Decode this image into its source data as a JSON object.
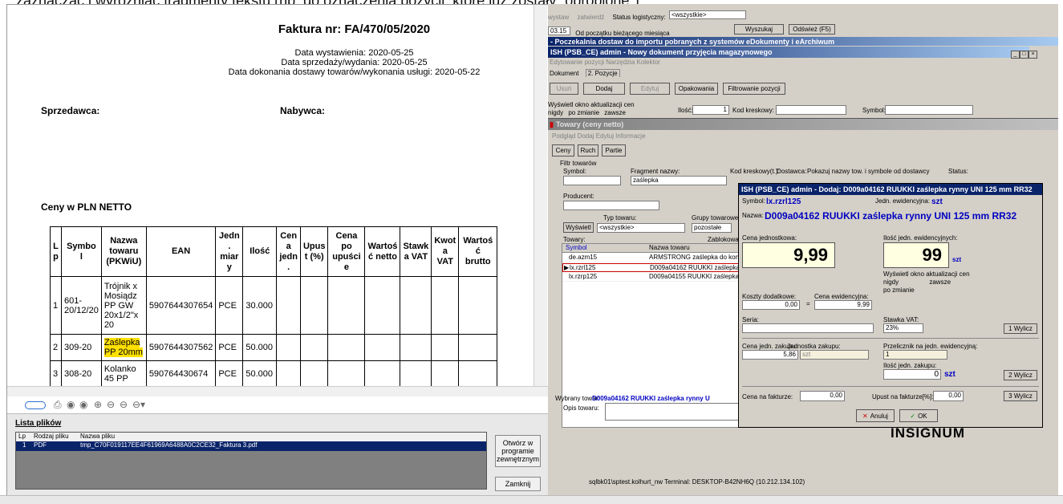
{
  "caption": "zaznaczać i wyróżniać fragmenty tekstu (np. do oznaczenia pozycji, które już zostały „obrobione\")",
  "invoice": {
    "title": "Faktura nr: FA/470/05/2020",
    "dates": [
      "Data wystawienia: 2020-05-25",
      "Data sprzedaży/wydania: 2020-05-25",
      "Data dokonania dostawy towarów/wykonania usługi: 2020-05-22"
    ],
    "seller": "Sprzedawca:",
    "buyer": "Nabywca:",
    "prices": "Ceny w PLN NETTO",
    "headers": [
      "Lp",
      "Symbol",
      "Nazwa towaru (PKWiU)",
      "EAN",
      "Jedn. miary",
      "Ilość",
      "Cena jedn.",
      "Upust (%)",
      "Cena po upuście",
      "Wartość netto",
      "Stawka VAT",
      "Kwota VAT",
      "Wartość brutto"
    ],
    "rows": [
      {
        "lp": "1",
        "symbol": "601-20/12/20",
        "name": "Trójnik x Mosiądz PP GW 20x1/2\"x 20",
        "ean": "5907644307654",
        "unit": "PCE",
        "qty": "30.000"
      },
      {
        "lp": "2",
        "symbol": "309-20",
        "name": "Zaślepka PP 20mm",
        "ean": "5907644307562",
        "unit": "PCE",
        "qty": "50.000"
      },
      {
        "lp": "3",
        "symbol": "308-20",
        "name": "Kolanko 45 PP",
        "ean": "590764430674",
        "unit": "PCE",
        "qty": "50.000"
      }
    ]
  },
  "files": {
    "title": "Lista plików",
    "cols": [
      "Lp",
      "Rodzaj pliku",
      "Nazwa pliku"
    ],
    "row": {
      "lp": "1",
      "type": "PDF",
      "name": "tmp_C70F019117EE4F61969A6488A0C2CE32_Faktura 3.pdf"
    },
    "open_btn": "Otwórz w programie zewnętrznym",
    "close_btn": "Zamknij"
  },
  "erp": {
    "top": {
      "c1": "wystaw",
      "c2": "zatwierdź",
      "status_label": "Status logistyczny:",
      "status_val": "<wszystkie>",
      "date": "03.15",
      "since": "Od początku bieżącego miesiąca",
      "search": "Wyszukaj",
      "refresh": "Odśwież (F5)"
    },
    "w_wait": "- Poczekalnia dostaw do importu pobranych z systemów eDokumenty i eArchiwum",
    "w_new": "ISH (PSB_CE) admin - Nowy dokument przyjęcia magazynowego",
    "menu1": "Edytowanie pozycji  Narzędzia  Kolektor",
    "tab_doc": "Dokument",
    "tab_pos": "2. Pozycje",
    "btn_del": "Usuń",
    "btn_add": "Dodaj",
    "btn_edit": "Edytuj",
    "btn_pack": "Opakowania",
    "btn_filter": "Filtrowanie pozycji",
    "show_label": "Wyświetl okno aktualizacji cen",
    "never": "nigdy",
    "change": "po zmianie",
    "always": "zawsze",
    "qty_label": "Ilość:",
    "qty_val": "1",
    "barcode_label": "Kod kreskowy:",
    "symbol_label": "Symbol:",
    "w_goods": "Towary (ceny netto)",
    "menu2": "Podgląd  Dodaj  Edytuj  Informacje",
    "tabs2": [
      "Ceny",
      "Ruch",
      "Partie"
    ],
    "filter": "Filtr towarów",
    "f_symbol": "Symbol:",
    "f_frag": "Fragment nazwy:",
    "f_frag_val": "zaślepka",
    "f_barcode": "Kod kreskowy(t.):",
    "f_supplier": "Dostawca:",
    "f_show": "Pokazuj nazwy tow. i symbole od dostawcy",
    "f_status": "Status:",
    "f_producer": "Producent:",
    "f_type": "Typ towaru:",
    "f_groups": "Grupy towarowe",
    "f_show_btn": "Wyświetl",
    "f_all": "<wszystkie>",
    "f_other": "pozostałe",
    "f_goods": "Towary:",
    "f_blocked": "Zablokowane",
    "grid_cols": [
      "Symbol",
      "Nazwa towaru"
    ],
    "grid": [
      [
        "de.azm15",
        "ARMSTRONG zaślepka do konstr"
      ],
      [
        "lx.rzrl125",
        "D009a04162 RUUKKI zaślepka ry"
      ],
      [
        "lx.rzrp125",
        "D009a04155 RUUKKI zaślepka r"
      ]
    ],
    "selected_label": "Wybrany towar:",
    "selected_val": "D009a04162 RUUKKI zaślepka rynny U",
    "desc_label": "Opis towaru:",
    "footer": "sqlbk01\\sptest.kolhurt_nw  Terminal: DESKTOP-B42NH6Q (10.212.134.102)",
    "brand": "INSIGNUM"
  },
  "dlg": {
    "title": "ISH (PSB_CE) admin - Dodaj: D009a04162 RUUKKI zaślepka rynny UNI 125 mm RR32",
    "sym_label": "Symbol:",
    "sym": "lx.rzrl125",
    "unit_label": "Jedn. ewidencyjna:",
    "unit": "szt",
    "name_label": "Nazwa:",
    "name": "D009a04162 RUUKKI zaślepka rynny UNI 125 mm RR32",
    "price_label": "Cena jednostkowa:",
    "price": "9,99",
    "qty_label": "Ilość jedn. ewidencyjnych:",
    "qty": "99",
    "szt": "szt",
    "upd_label": "Wyświetl okno aktualizacji cen",
    "never": "nigdy",
    "always": "zawsze",
    "change": "po zmianie",
    "cost_label": "Koszty dodatkowe:",
    "cost": "0,00",
    "ev_label": "Cena ewidencyjna:",
    "ev": "9,99",
    "serial_label": "Seria:",
    "vat_label": "Stawka VAT:",
    "vat": "23%",
    "calc1": "1 Wylicz",
    "buy_label": "Cena jedn. zakupu:",
    "buy": "5,86",
    "unit_buy_label": "Jednostka zakupu:",
    "unit_buy": "szt",
    "conv_label": "Przelicznik na jedn. ewidencyjną:",
    "conv": "1",
    "qty_buy_label": "Ilość jedn. zakupu:",
    "qty_buy": "0",
    "szt2": "szt",
    "calc2": "2 Wylicz",
    "inv_price_label": "Cena na fakturze:",
    "inv_price": "0,00",
    "disc_label": "Upust na fakturze[%]:",
    "disc": "0,00",
    "calc3": "3 Wylicz",
    "cancel": "Anuluj",
    "ok": "OK"
  }
}
